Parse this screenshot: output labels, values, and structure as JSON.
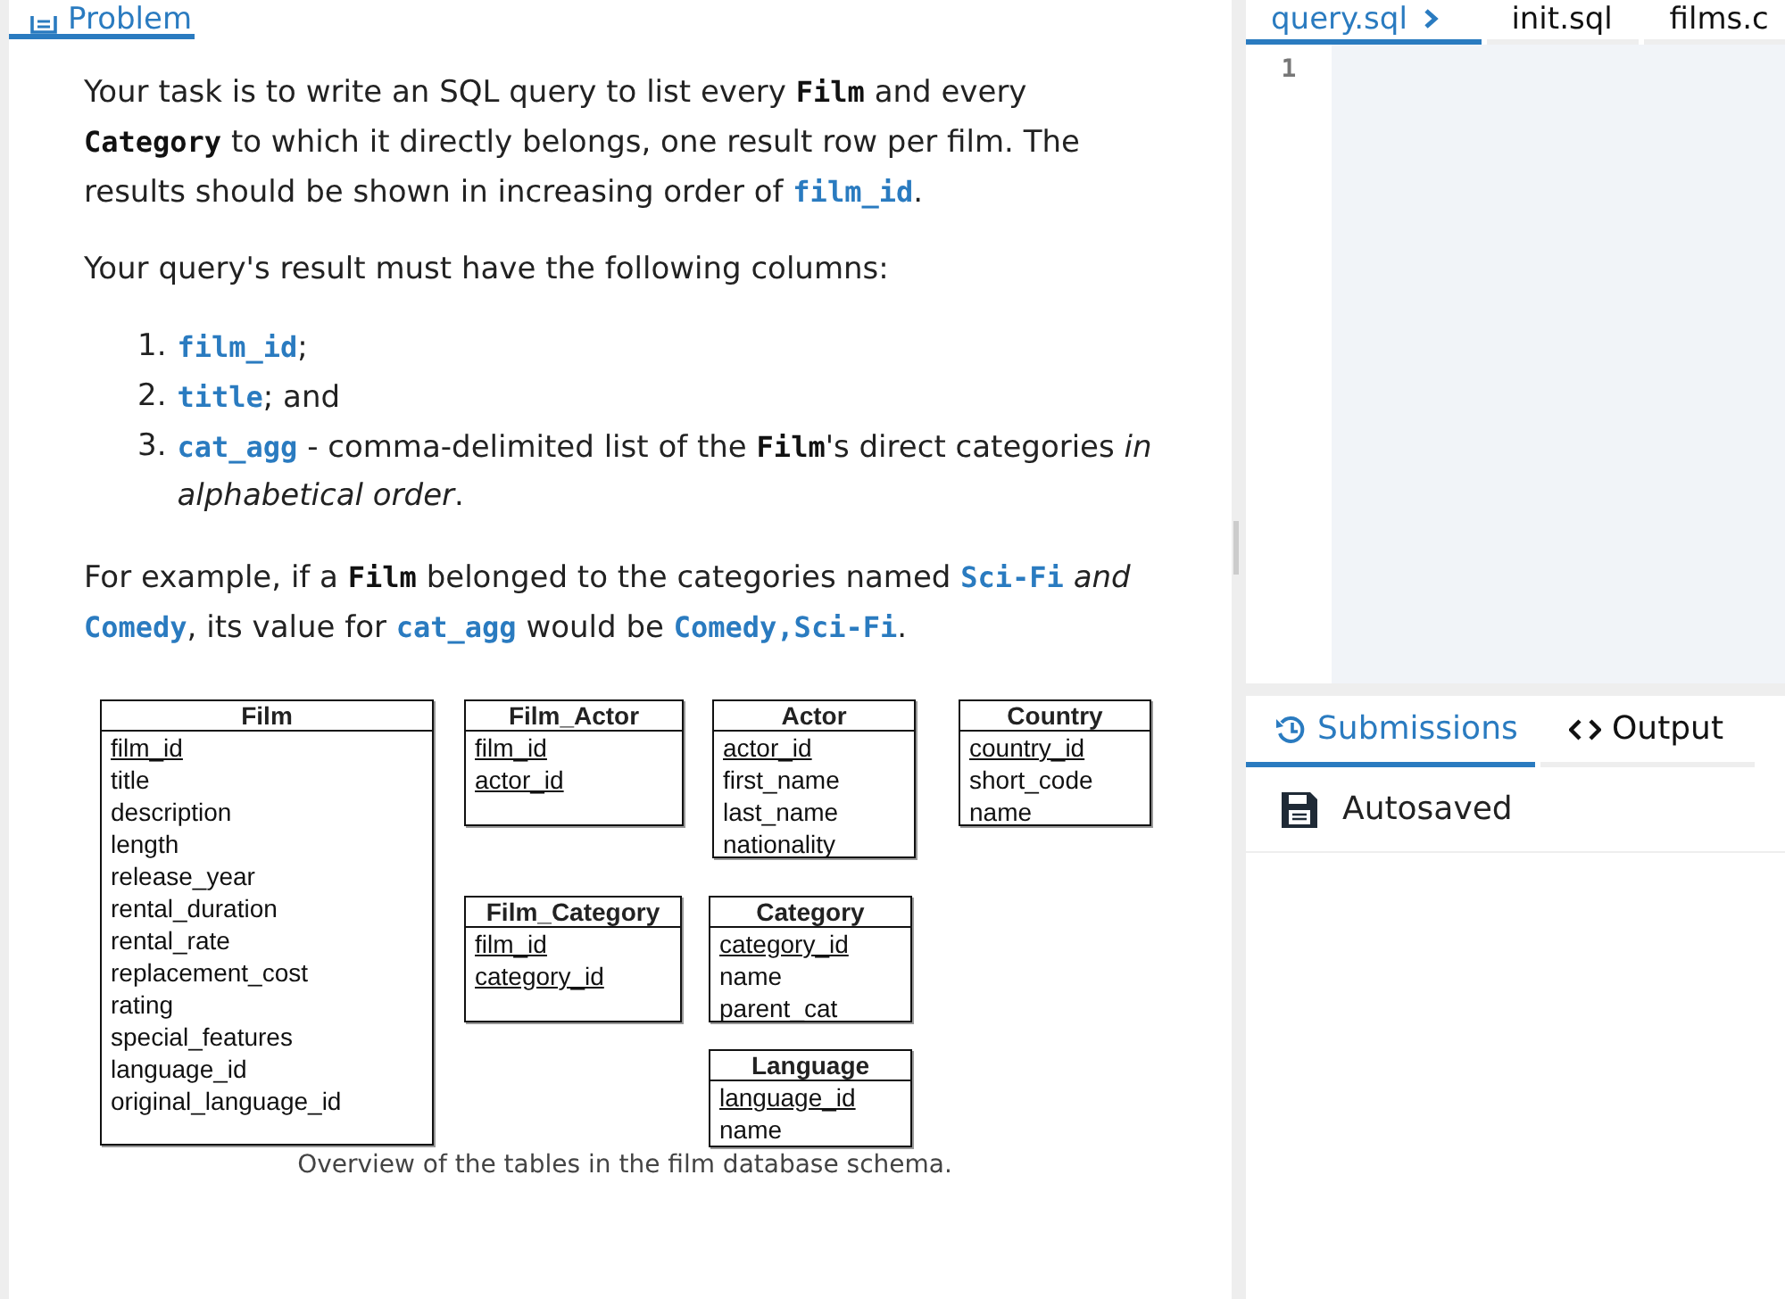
{
  "problem_tab": {
    "label": "Problem",
    "selected": true
  },
  "intro": [
    {
      "kind": "text",
      "text": "Your task is to write an SQL query to list every "
    },
    {
      "kind": "name",
      "text": "Film"
    },
    {
      "kind": "text",
      "text": " and every "
    },
    {
      "kind": "name",
      "text": "Category"
    },
    {
      "kind": "text",
      "text": " to which it directly belongs, one result row per film. The results should be shown in increasing order of "
    },
    {
      "kind": "code",
      "text": "film_id"
    },
    {
      "kind": "text",
      "text": "."
    }
  ],
  "columns_intro": [
    {
      "kind": "text",
      "text": "Your query's result must have the following columns:"
    }
  ],
  "columns": [
    {
      "number": "1.",
      "parts": [
        {
          "kind": "code",
          "text": "film_id"
        },
        {
          "kind": "text",
          "text": ";"
        }
      ]
    },
    {
      "number": "2.",
      "parts": [
        {
          "kind": "code",
          "text": "title"
        },
        {
          "kind": "text",
          "text": "; and"
        }
      ]
    },
    {
      "number": "3.",
      "parts": [
        {
          "kind": "code",
          "text": "cat_agg"
        },
        {
          "kind": "text",
          "text": " - comma-delimited list of the "
        },
        {
          "kind": "name",
          "text": "Film"
        },
        {
          "kind": "text",
          "text": "'s direct categories "
        },
        {
          "kind": "italic",
          "text": "in alphabetical order"
        },
        {
          "kind": "text",
          "text": "."
        }
      ]
    }
  ],
  "example": [
    {
      "kind": "text",
      "text": "For example, if a "
    },
    {
      "kind": "name",
      "text": "Film"
    },
    {
      "kind": "text",
      "text": " belonged to the categories named "
    },
    {
      "kind": "code",
      "text": "Sci-Fi"
    },
    {
      "kind": "italic",
      "text": " and "
    },
    {
      "kind": "code",
      "text": "Comedy"
    },
    {
      "kind": "text",
      "text": ", its value for "
    },
    {
      "kind": "code",
      "text": "cat_agg"
    },
    {
      "kind": "text",
      "text": " would be "
    },
    {
      "kind": "code",
      "text": "Comedy,Sci-Fi"
    },
    {
      "kind": "text",
      "text": "."
    }
  ],
  "schema": {
    "tables": [
      {
        "name": "Film",
        "fields": [
          {
            "name": "film_id",
            "key": true
          },
          {
            "name": "title",
            "key": false
          },
          {
            "name": "description",
            "key": false
          },
          {
            "name": "length",
            "key": false
          },
          {
            "name": "release_year",
            "key": false
          },
          {
            "name": "rental_duration",
            "key": false
          },
          {
            "name": "rental_rate",
            "key": false
          },
          {
            "name": "replacement_cost",
            "key": false
          },
          {
            "name": "rating",
            "key": false
          },
          {
            "name": "special_features",
            "key": false
          },
          {
            "name": "language_id",
            "key": false
          },
          {
            "name": "original_language_id",
            "key": false
          }
        ]
      },
      {
        "name": "Film_Actor",
        "fields": [
          {
            "name": "film_id",
            "key": true
          },
          {
            "name": "actor_id",
            "key": true
          }
        ]
      },
      {
        "name": "Actor",
        "fields": [
          {
            "name": "actor_id",
            "key": true
          },
          {
            "name": "first_name",
            "key": false
          },
          {
            "name": "last_name",
            "key": false
          },
          {
            "name": "nationality",
            "key": false
          }
        ]
      },
      {
        "name": "Country",
        "fields": [
          {
            "name": "country_id",
            "key": true
          },
          {
            "name": "short_code",
            "key": false
          },
          {
            "name": "name",
            "key": false
          }
        ]
      },
      {
        "name": "Film_Category",
        "fields": [
          {
            "name": "film_id",
            "key": true
          },
          {
            "name": "category_id",
            "key": true
          }
        ]
      },
      {
        "name": "Category",
        "fields": [
          {
            "name": "category_id",
            "key": true
          },
          {
            "name": "name",
            "key": false
          },
          {
            "name": "parent_cat",
            "key": false
          }
        ]
      },
      {
        "name": "Language",
        "fields": [
          {
            "name": "language_id",
            "key": true
          },
          {
            "name": "name",
            "key": false
          }
        ]
      }
    ],
    "caption": "Overview of the tables in the film database schema."
  },
  "editor_tabs": [
    {
      "label": "query.sql",
      "selected": true
    },
    {
      "label": "init.sql",
      "selected": false
    },
    {
      "label": "films.c",
      "selected": false
    }
  ],
  "line_numbers": [
    "1"
  ],
  "result_tabs": [
    {
      "label": "Submissions",
      "selected": true
    },
    {
      "label": "Output",
      "selected": false
    }
  ],
  "save_status": "Autosaved"
}
